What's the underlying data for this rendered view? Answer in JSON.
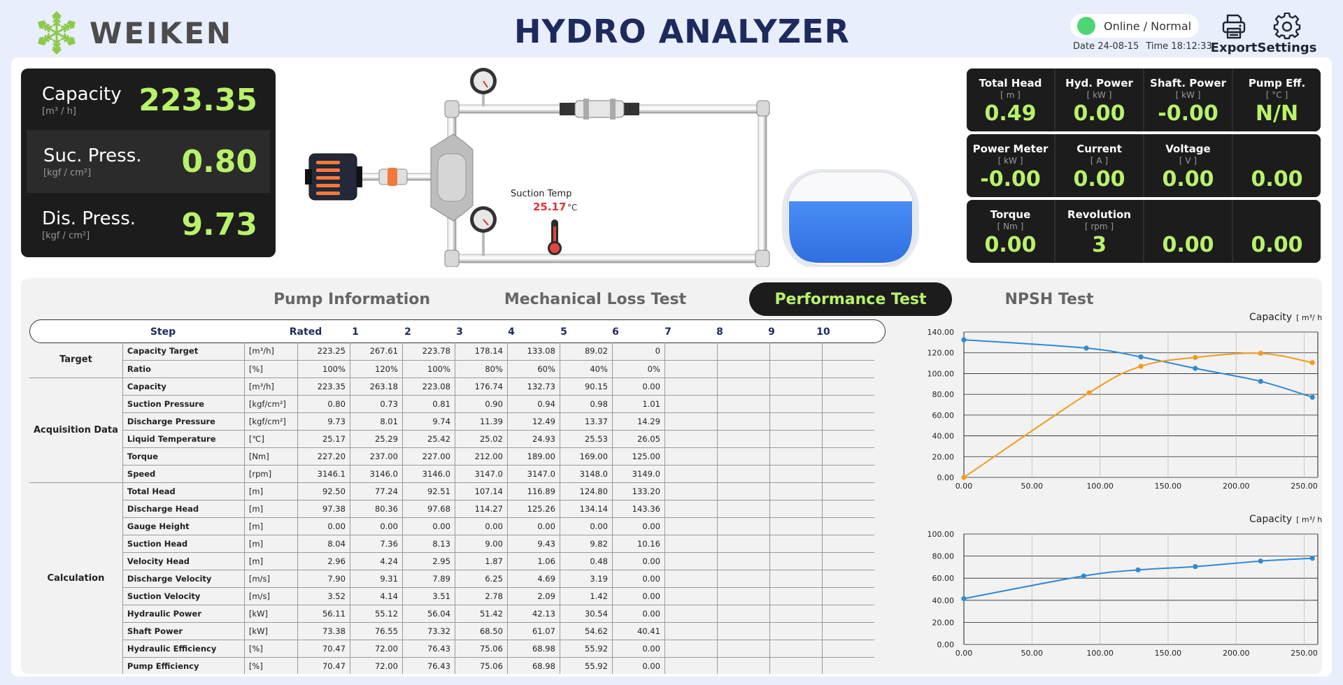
{
  "header": {
    "brand": "WEIKEN",
    "title": "HYDRO ANALYZER",
    "status": "Online / Normal",
    "date_label": "Date 24-08-15",
    "time_label": "Time 18:12:33",
    "export_label": "Export",
    "settings_label": "Settings"
  },
  "left_metrics": [
    {
      "label": "Capacity",
      "unit": "[m³ / h]",
      "value": "223.35"
    },
    {
      "label": "Suc. Press.",
      "unit": "[kgf / cm²]",
      "value": "0.80"
    },
    {
      "label": "Dis. Press.",
      "unit": "[kgf / cm²]",
      "value": "9.73"
    }
  ],
  "diagram": {
    "suction_temp_label": "Suction Temp",
    "suction_temp_value": "25.17",
    "suction_temp_unit": "°C",
    "tank_level": 0.6
  },
  "right_metrics": [
    [
      {
        "title": "Total Head",
        "unit": "[ m ]",
        "value": "0.49"
      },
      {
        "title": "Hyd. Power",
        "unit": "[ kW ]",
        "value": "0.00"
      },
      {
        "title": "Shaft. Power",
        "unit": "[ kW ]",
        "value": "-0.00"
      },
      {
        "title": "Pump Eff.",
        "unit": "[ °C ]",
        "value": "N/N"
      }
    ],
    [
      {
        "title": "Power Meter",
        "unit": "[ kW ]",
        "value": "-0.00"
      },
      {
        "title": "Current",
        "unit": "[ A ]",
        "value": "0.00"
      },
      {
        "title": "Voltage",
        "unit": "[ V ]",
        "value": "0.00"
      },
      {
        "title": "",
        "unit": "",
        "value": "0.00"
      }
    ],
    [
      {
        "title": "Torque",
        "unit": "[ Nm ]",
        "value": "0.00"
      },
      {
        "title": "Revolution",
        "unit": "[ rpm ]",
        "value": "3"
      },
      {
        "title": "",
        "unit": "",
        "value": "0.00"
      },
      {
        "title": "",
        "unit": "",
        "value": "0.00"
      }
    ]
  ],
  "tabs": [
    {
      "label": "Pump Information",
      "active": false
    },
    {
      "label": "Mechanical Loss Test",
      "active": false
    },
    {
      "label": "Performance Test",
      "active": true
    },
    {
      "label": "NPSH Test",
      "active": false
    }
  ],
  "table": {
    "header": [
      "Step",
      "Rated",
      "1",
      "2",
      "3",
      "4",
      "5",
      "6",
      "7",
      "8",
      "9",
      "10"
    ],
    "groups": [
      {
        "name": "Target",
        "rows": [
          {
            "name": "Capacity Target",
            "unit": "[m³/h]",
            "values": [
              "223.25",
              "267.61",
              "223.78",
              "178.14",
              "133.08",
              "89.02",
              "0"
            ]
          },
          {
            "name": "Ratio",
            "unit": "[%]",
            "values": [
              "100%",
              "120%",
              "100%",
              "80%",
              "60%",
              "40%",
              "0%"
            ]
          }
        ]
      },
      {
        "name": "Acquisition Data",
        "rows": [
          {
            "name": "Capacity",
            "unit": "[m³/h]",
            "values": [
              "223.35",
              "263.18",
              "223.08",
              "176.74",
              "132.73",
              "90.15",
              "0.00"
            ]
          },
          {
            "name": "Suction Pressure",
            "unit": "[kgf/cm²]",
            "values": [
              "0.80",
              "0.73",
              "0.81",
              "0.90",
              "0.94",
              "0.98",
              "1.01"
            ]
          },
          {
            "name": "Discharge Pressure",
            "unit": "[kgf/cm²]",
            "values": [
              "9.73",
              "8.01",
              "9.74",
              "11.39",
              "12.49",
              "13.37",
              "14.29"
            ]
          },
          {
            "name": "Liquid Temperature",
            "unit": "[℃]",
            "values": [
              "25.17",
              "25.29",
              "25.42",
              "25.02",
              "24.93",
              "25.53",
              "26.05"
            ]
          },
          {
            "name": "Torque",
            "unit": "[Nm]",
            "values": [
              "227.20",
              "237.00",
              "227.00",
              "212.00",
              "189.00",
              "169.00",
              "125.00"
            ]
          },
          {
            "name": "Speed",
            "unit": "[rpm]",
            "values": [
              "3146.1",
              "3146.0",
              "3146.0",
              "3147.0",
              "3147.0",
              "3148.0",
              "3149.0"
            ]
          }
        ]
      },
      {
        "name": "Calculation",
        "rows": [
          {
            "name": "Total Head",
            "unit": "[m]",
            "values": [
              "92.50",
              "77.24",
              "92.51",
              "107.14",
              "116.89",
              "124.80",
              "133.20"
            ]
          },
          {
            "name": "Discharge Head",
            "unit": "[m]",
            "values": [
              "97.38",
              "80.36",
              "97.68",
              "114.27",
              "125.26",
              "134.14",
              "143.36"
            ]
          },
          {
            "name": "Gauge Height",
            "unit": "[m]",
            "values": [
              "0.00",
              "0.00",
              "0.00",
              "0.00",
              "0.00",
              "0.00",
              "0.00"
            ]
          },
          {
            "name": "Suction Head",
            "unit": "[m]",
            "values": [
              "8.04",
              "7.36",
              "8.13",
              "9.00",
              "9.43",
              "9.82",
              "10.16"
            ]
          },
          {
            "name": "Velocity Head",
            "unit": "[m]",
            "values": [
              "2.96",
              "4.24",
              "2.95",
              "1.87",
              "1.06",
              "0.48",
              "0.00"
            ]
          },
          {
            "name": "Discharge Velocity",
            "unit": "[m/s]",
            "values": [
              "7.90",
              "9.31",
              "7.89",
              "6.25",
              "4.69",
              "3.19",
              "0.00"
            ]
          },
          {
            "name": "Suction Velocity",
            "unit": "[m/s]",
            "values": [
              "3.52",
              "4.14",
              "3.51",
              "2.78",
              "2.09",
              "1.42",
              "0.00"
            ]
          },
          {
            "name": "Hydraulic Power",
            "unit": "[kW]",
            "values": [
              "56.11",
              "55.12",
              "56.04",
              "51.42",
              "42.13",
              "30.54",
              "0.00"
            ]
          },
          {
            "name": "Shaft Power",
            "unit": "[kW]",
            "values": [
              "73.38",
              "76.55",
              "73.32",
              "68.50",
              "61.07",
              "54.62",
              "40.41"
            ]
          },
          {
            "name": "Hydraulic Efficiency",
            "unit": "[%]",
            "values": [
              "70.47",
              "72.00",
              "76.43",
              "75.06",
              "68.98",
              "55.92",
              "0.00"
            ]
          },
          {
            "name": "Pump Efficiency",
            "unit": "[%]",
            "values": [
              "70.47",
              "72.00",
              "76.43",
              "75.06",
              "68.98",
              "55.92",
              "0.00"
            ]
          }
        ]
      }
    ]
  },
  "chart_data": [
    {
      "type": "line",
      "title": "Capacity",
      "unit_label": "[ m³/ h ]",
      "xlim": [
        0,
        260
      ],
      "ylim": [
        0,
        140
      ],
      "x_ticks": [
        "0.00",
        "50.00",
        "100.00",
        "150.00",
        "200.00",
        "250.00"
      ],
      "y_ticks": [
        "0.00",
        "20.00",
        "40.00",
        "60.00",
        "80.00",
        "100.00",
        "120.00",
        "140.00"
      ],
      "grid": true,
      "colors": [
        "#2f8ad3",
        "#f59a1e"
      ],
      "series": [
        {
          "x": [
            0,
            90,
            130,
            170,
            218,
            256
          ],
          "y": [
            132.5,
            124.5,
            116.0,
            105.0,
            92.5,
            77.2
          ]
        },
        {
          "x": [
            0,
            92,
            130,
            170,
            218,
            256
          ],
          "y": [
            0,
            81.5,
            107.0,
            115.5,
            119.5,
            110.5
          ]
        }
      ]
    },
    {
      "type": "line",
      "title": "Capacity",
      "unit_label": "[ m³/ h ]",
      "xlim": [
        0,
        260
      ],
      "ylim": [
        0,
        100
      ],
      "x_ticks": [
        "0.00",
        "50.00",
        "100.00",
        "150.00",
        "200.00",
        "250.00"
      ],
      "y_ticks": [
        "0.00",
        "20.00",
        "40.00",
        "60.00",
        "80.00",
        "100.00"
      ],
      "grid": true,
      "colors": [
        "#2f8ad3"
      ],
      "series": [
        {
          "x": [
            0,
            88,
            128,
            170,
            218,
            256
          ],
          "y": [
            41.5,
            62.0,
            67.5,
            70.5,
            75.5,
            78.0
          ]
        }
      ]
    }
  ]
}
